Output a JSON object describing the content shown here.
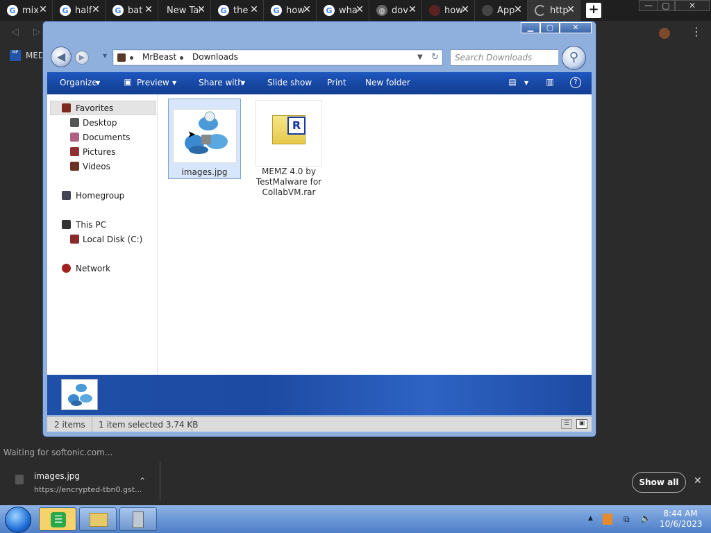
{
  "browser": {
    "tabs": [
      {
        "title": "mix",
        "icon": "google-icon"
      },
      {
        "title": "half",
        "icon": "google-icon"
      },
      {
        "title": "bat",
        "icon": "google-icon"
      },
      {
        "title": "New Tab",
        "icon": "none"
      },
      {
        "title": "the",
        "icon": "google-icon"
      },
      {
        "title": "how",
        "icon": "google-icon"
      },
      {
        "title": "wha",
        "icon": "google-icon"
      },
      {
        "title": "dov",
        "icon": "globe-icon"
      },
      {
        "title": "how",
        "icon": "site-icon"
      },
      {
        "title": "App",
        "icon": "site-icon"
      },
      {
        "title": "http",
        "icon": "loading-icon"
      }
    ],
    "tab_close_glyph": "✕",
    "new_tab_glyph": "+",
    "bookmark_label": "MED",
    "status_text": "Waiting for softonic.com..."
  },
  "explorer": {
    "breadcrumb": [
      "MrBeast",
      "Downloads"
    ],
    "search_placeholder": "Search Downloads",
    "commands": [
      "Organize",
      "Preview",
      "Share with",
      "Slide show",
      "Print",
      "New folder"
    ],
    "nav": {
      "favorites": "Favorites",
      "favorites_items": [
        "Desktop",
        "Documents",
        "Pictures",
        "Videos"
      ],
      "homegroup": "Homegroup",
      "this_pc": "This PC",
      "local_disk": "Local Disk (C:)",
      "network": "Network"
    },
    "files": [
      {
        "name": "images.jpg",
        "selected": true
      },
      {
        "name": "MEMZ 4.0 by TestMalware for CollabVM.rar",
        "selected": false
      }
    ],
    "status": {
      "count": "2 items",
      "selection": "1 item selected  3.74 KB"
    }
  },
  "download": {
    "filename": "images.jpg",
    "url": "https://encrypted-tbn0.gst...",
    "show_all": "Show all"
  },
  "taskbar": {
    "time": "8:44 AM",
    "date": "10/6/2023"
  }
}
